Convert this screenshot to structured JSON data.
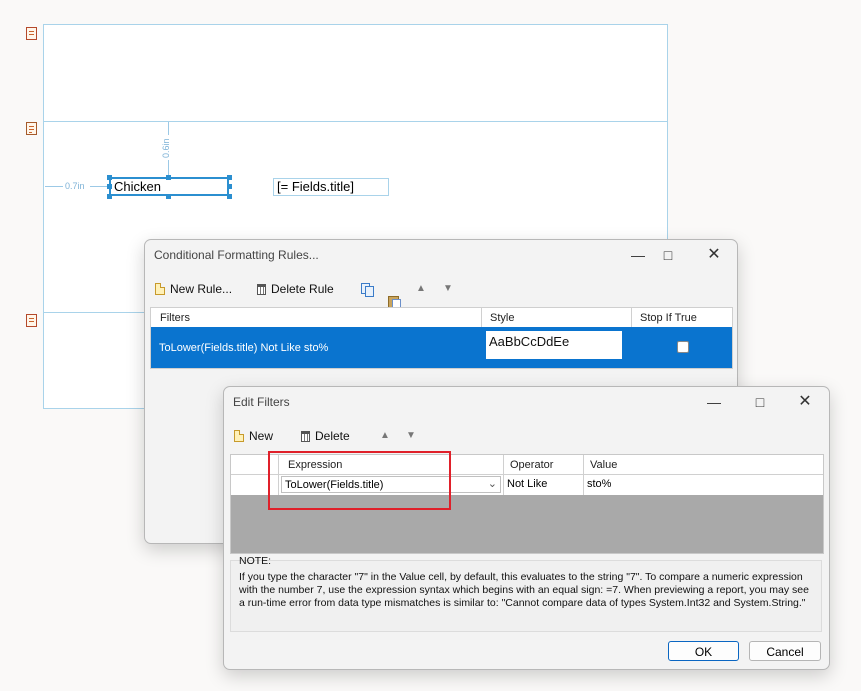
{
  "designer": {
    "textbox1": "Chicken",
    "textbox2": "[= Fields.title]",
    "guide_left": "0.7in",
    "guide_top": "0.6in"
  },
  "cfr_dialog": {
    "title": "Conditional Formatting Rules...",
    "toolbar": {
      "new_rule": "New Rule...",
      "delete_rule": "Delete Rule"
    },
    "columns": {
      "filters": "Filters",
      "style": "Style",
      "stop_if_true": "Stop If True"
    },
    "row": {
      "filter": "ToLower(Fields.title) Not Like sto%",
      "style_preview": "AaBbCcDdEe",
      "stop_if_true": false
    }
  },
  "edit_filters": {
    "title": "Edit Filters",
    "toolbar": {
      "new": "New",
      "delete": "Delete"
    },
    "columns": {
      "expression": "Expression",
      "operator": "Operator",
      "value": "Value"
    },
    "row": {
      "expression": "ToLower(Fields.title)",
      "operator": "Not Like",
      "value": "sto%"
    },
    "note_label": "NOTE:",
    "note_text": "If you type the character \"7\" in the Value cell, by default, this evaluates to the string \"7\". To compare a numeric expression with the number 7, use the expression syntax which begins with an equal sign: =7. When previewing a report, you may see a run-time error from data type mismatches is similar to: \"Cannot compare data of types System.Int32 and System.String.\"",
    "ok": "OK",
    "cancel": "Cancel"
  },
  "colors": {
    "accent": "#0a74cf",
    "highlight": "#e0202a",
    "guide": "#a9d3ea"
  }
}
